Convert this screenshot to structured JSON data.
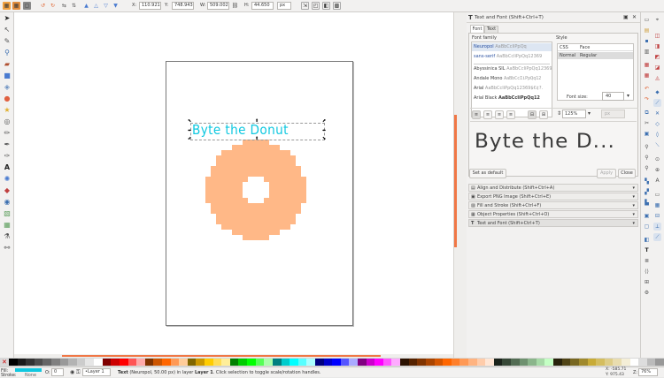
{
  "toolbar": {
    "x_label": "X:",
    "x_value": "110.921",
    "y_label": "Y:",
    "y_value": "748.943",
    "w_label": "W:",
    "w_value": "509.002",
    "h_label": "H:",
    "h_value": "44.650",
    "unit": "px"
  },
  "panel": {
    "title": "Text and Font (Shift+Ctrl+T)",
    "tabs": [
      "Font",
      "Text"
    ],
    "font_family_label": "Font family",
    "style_label": "Style",
    "fonts": [
      {
        "name": "Neuropol",
        "sample": "AaBbCcIiPpQq"
      },
      {
        "name": "sans-serif",
        "sample": "AaBbCcIiPpQq12369"
      },
      {
        "name": "Abyssinica SIL",
        "sample": "AaBbCcIiPpQq12369"
      },
      {
        "name": "Andale Mono",
        "sample": "AaBbCcIiPpQq12"
      },
      {
        "name": "Arial",
        "sample": "AaBbCcIiPpQq12369$€¢?."
      },
      {
        "name": "Arial Black",
        "sample": "AaBbCcIiPpQq12"
      }
    ],
    "style_headers": [
      "CSS",
      "Face"
    ],
    "style_row": {
      "css": "Normal",
      "face": "Regular"
    },
    "font_size_label": "Font size:",
    "font_size": "40",
    "line_spacing": "125%",
    "preview_text": "Byte the D...",
    "set_default": "Set as default",
    "apply": "Apply",
    "close": "Close",
    "docked": [
      "Align and Distribute (Shift+Ctrl+A)",
      "Export PNG Image (Shift+Ctrl+E)",
      "Fill and Stroke (Shift+Ctrl+F)",
      "Object Properties (Shift+Ctrl+O)",
      "Text and Font (Shift+Ctrl+T)"
    ]
  },
  "canvas": {
    "text": "Byte the Donut",
    "text_color": "#10c8e0",
    "donut_color": "#ffb887"
  },
  "status": {
    "fill_label": "Fill:",
    "stroke_label": "Stroke:",
    "stroke_value": "None",
    "opacity": "0",
    "layer": "•Layer 1",
    "message_prefix": "Text",
    "message": " (Neuropol, 50.00 px) in layer ",
    "message_layer": "Layer 1",
    "message_suffix": ". Click selection to toggle scale/rotation handles.",
    "coord_x": "X: -585.71",
    "coord_y": "Y: 975.43",
    "zoom_label": "Z:",
    "zoom": "76%"
  },
  "colors": {
    "fill_swatch": "#10c8e0",
    "accent": "#f07746"
  }
}
